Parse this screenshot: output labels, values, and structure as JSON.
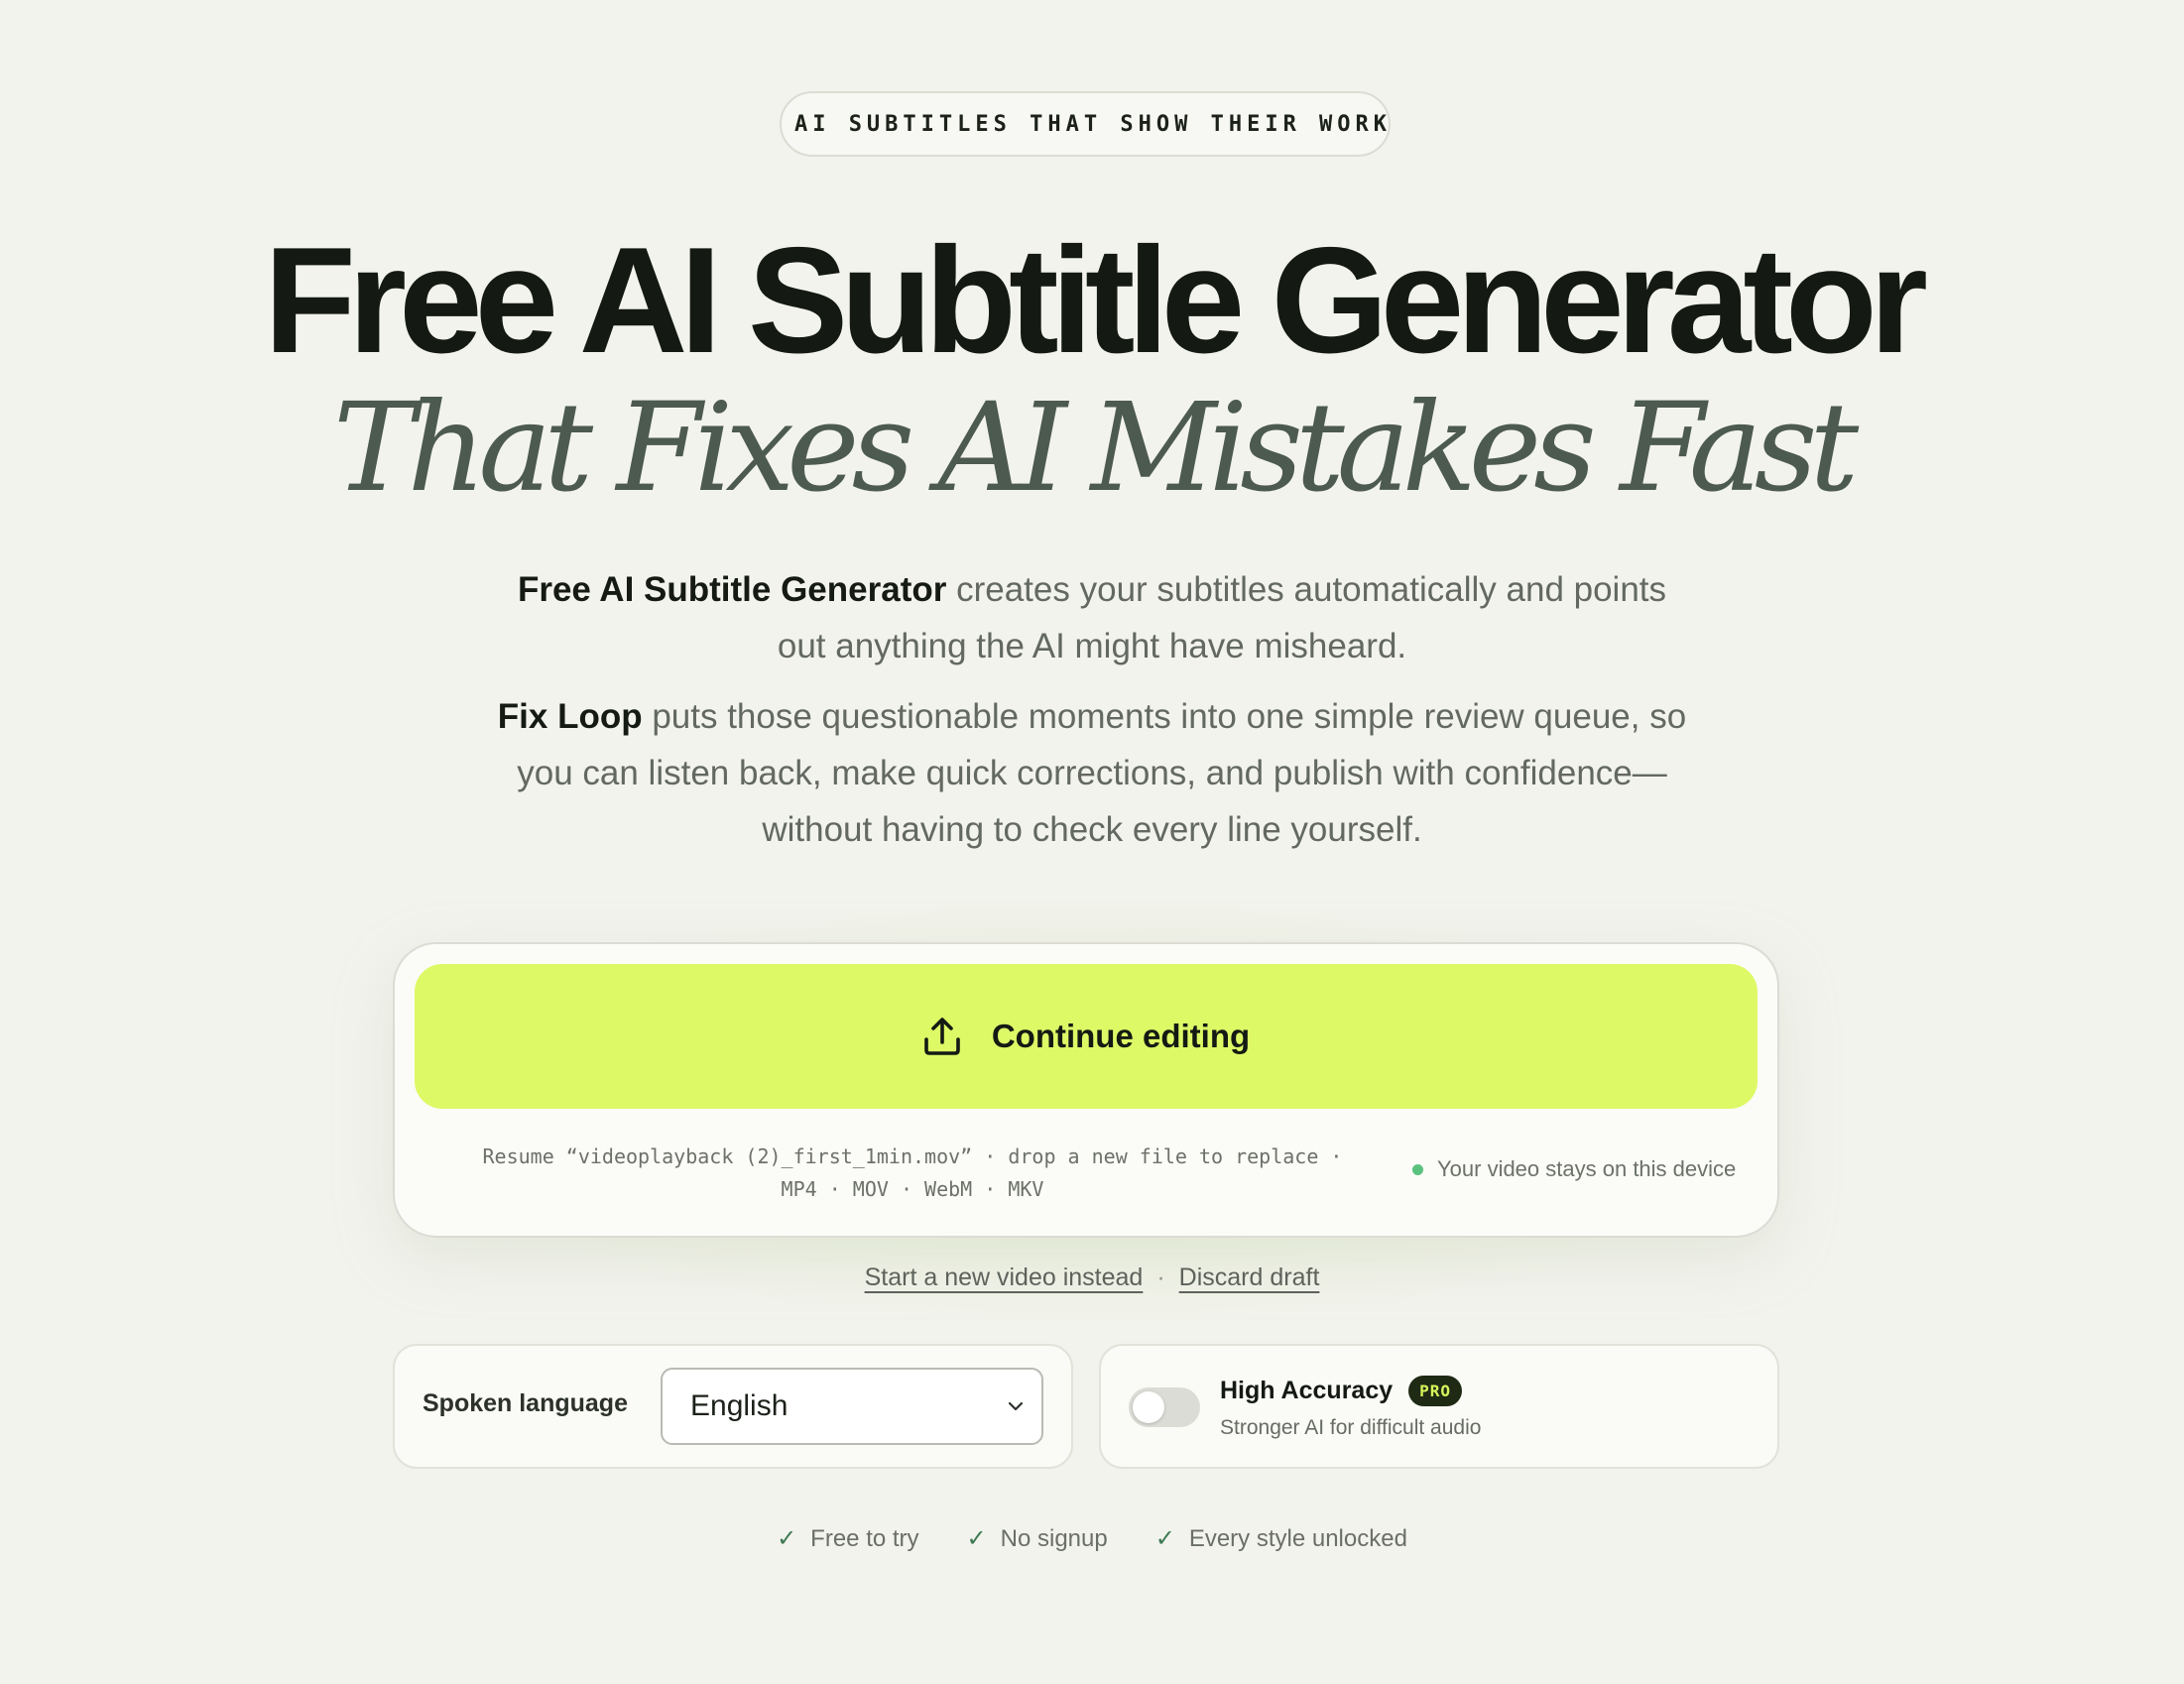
{
  "badge": {
    "text": "AI SUBTITLES THAT SHOW THEIR WORK",
    "dot_color": "#59c27f"
  },
  "hero": {
    "title": "Free AI Subtitle Generator",
    "subtitle": "That Fixes AI Mistakes Fast"
  },
  "description": {
    "p1_bold": "Free AI Subtitle Generator",
    "p1_rest": " creates your subtitles automatically and points out anything the AI might have misheard.",
    "p2_bold": "Fix Loop",
    "p2_rest": " puts those questionable moments into one simple review queue, so you can listen back, make quick corrections, and publish with confidence—without having to check every line yourself."
  },
  "upload": {
    "button_label": "Continue editing",
    "button_icon": "upload-icon",
    "accent_color": "#def966",
    "resume_line": "Resume “videoplayback (2)_first_1min.mov” · drop a new file to replace ·",
    "formats_line": "MP4 · MOV · WebM · MKV",
    "device_note": "Your video stays on this device"
  },
  "links": {
    "new_video": "Start a new video instead",
    "separator": "·",
    "discard": "Discard draft"
  },
  "language": {
    "label": "Spoken language",
    "selected": "English"
  },
  "accuracy": {
    "title": "High Accuracy",
    "badge": "PRO",
    "subtitle": "Stronger AI for difficult audio",
    "enabled": false
  },
  "features": [
    {
      "icon": "checkmark-icon",
      "check": "✓",
      "label": "Free to try"
    },
    {
      "icon": "checkmark-icon",
      "check": "✓",
      "label": "No signup"
    },
    {
      "icon": "checkmark-icon",
      "check": "✓",
      "label": "Every style unlocked"
    }
  ]
}
